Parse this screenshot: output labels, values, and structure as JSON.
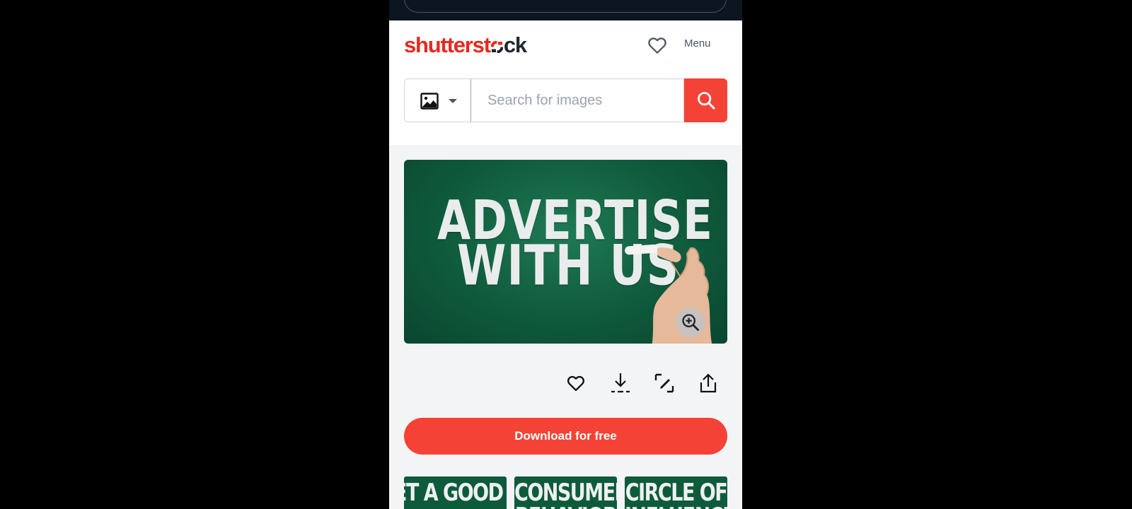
{
  "header": {
    "logo": {
      "part1": "shutterst",
      "part2": "ck"
    },
    "favorites_icon": "heart-outline-icon",
    "menu_label": "Menu"
  },
  "search": {
    "type_icon": "image-icon",
    "placeholder": "Search for images",
    "value": "",
    "button_icon": "search-icon"
  },
  "hero": {
    "line1": "ADVERTISE",
    "line2": "WITH US",
    "zoom_icon": "zoom-in-icon"
  },
  "actions": [
    {
      "name": "favorite",
      "icon": "heart-icon"
    },
    {
      "name": "download",
      "icon": "download-icon"
    },
    {
      "name": "edit",
      "icon": "edit-icon"
    },
    {
      "name": "share",
      "icon": "share-icon"
    }
  ],
  "download_button": "Download for free",
  "related": [
    {
      "line1": "ET A GOOD",
      "line2": ""
    },
    {
      "line1": "CONSUMER",
      "line2": "BEHAVIOR"
    },
    {
      "line1": "CIRCLE OF",
      "line2": "INFLUENCE"
    }
  ],
  "colors": {
    "accent": "#f44336",
    "logo_red": "#e8281e",
    "topbar": "#0d1520",
    "chalkboard": "#0f5a3c"
  }
}
